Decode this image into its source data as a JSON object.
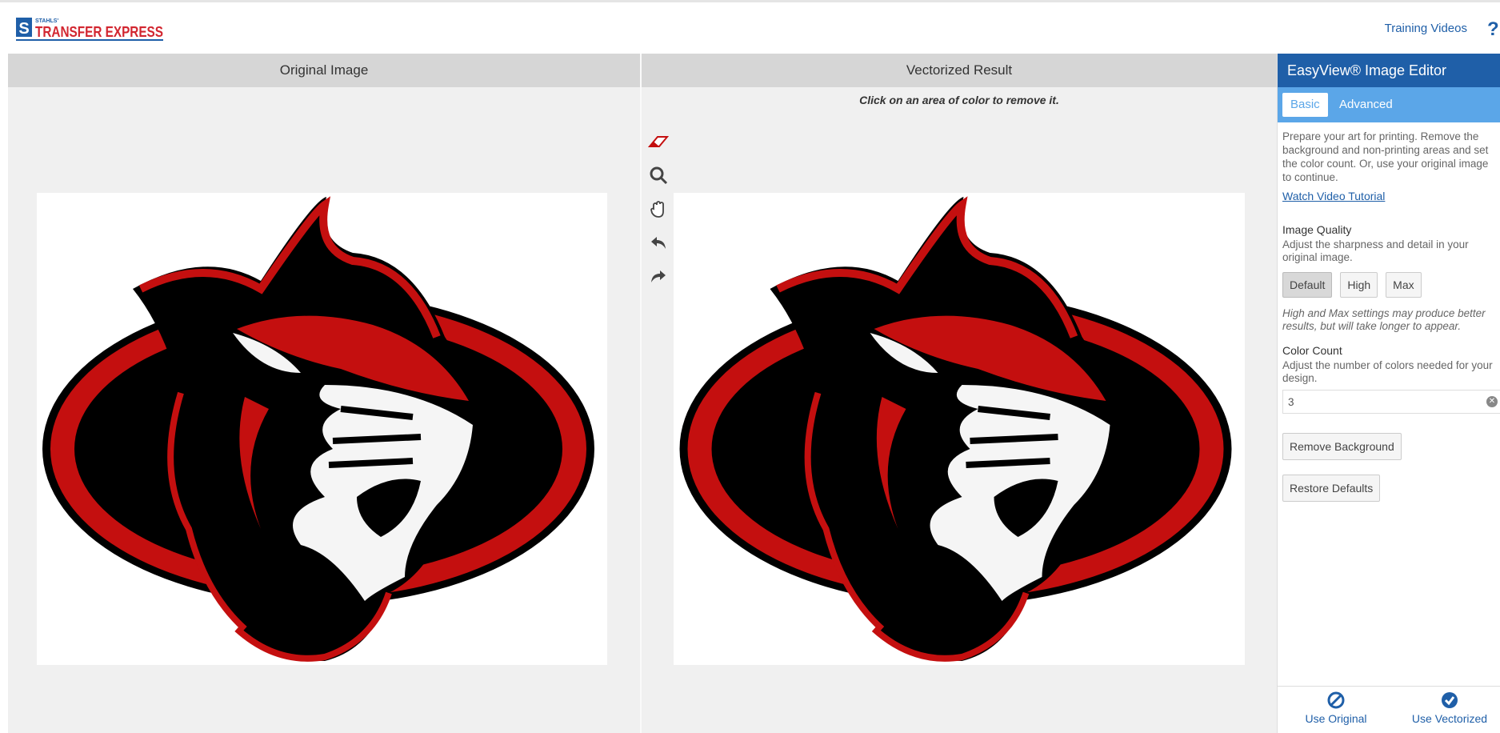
{
  "header": {
    "logo_small": "STAHLS'",
    "logo_text": "TRANSFER EXPRESS",
    "training_link": "Training Videos",
    "help_icon": "?"
  },
  "original_pane": {
    "title": "Original Image"
  },
  "vectorized_pane": {
    "title": "Vectorized Result",
    "instruction": "Click on an area of color to remove it."
  },
  "tools": [
    "eraser-icon",
    "zoom-icon",
    "hand-pan-icon",
    "undo-icon",
    "redo-icon"
  ],
  "editor": {
    "title": "EasyView® Image Editor",
    "tabs": {
      "basic": "Basic",
      "advanced": "Advanced"
    },
    "intro": "Prepare your art for printing. Remove the background and non-printing areas and set the color count. Or, use your original image to continue.",
    "video_link": "Watch Video Tutorial",
    "image_quality": {
      "title": "Image Quality",
      "desc": "Adjust the sharpness and detail in your original image.",
      "options": [
        "Default",
        "High",
        "Max"
      ],
      "selected": "Default",
      "note": "High and Max settings may produce better results, but will take longer to appear."
    },
    "color_count": {
      "title": "Color Count",
      "desc": "Adjust the number of colors needed for your design.",
      "value": "3"
    },
    "remove_background": "Remove Background",
    "restore_defaults": "Restore Defaults",
    "footer": {
      "use_original": "Use Original",
      "use_vectorized": "Use Vectorized"
    }
  },
  "colors": {
    "brand_blue": "#1f5fa8",
    "tab_blue": "#5ba6e8",
    "logo_red": "#d22630",
    "art_red": "#c40f0f"
  }
}
